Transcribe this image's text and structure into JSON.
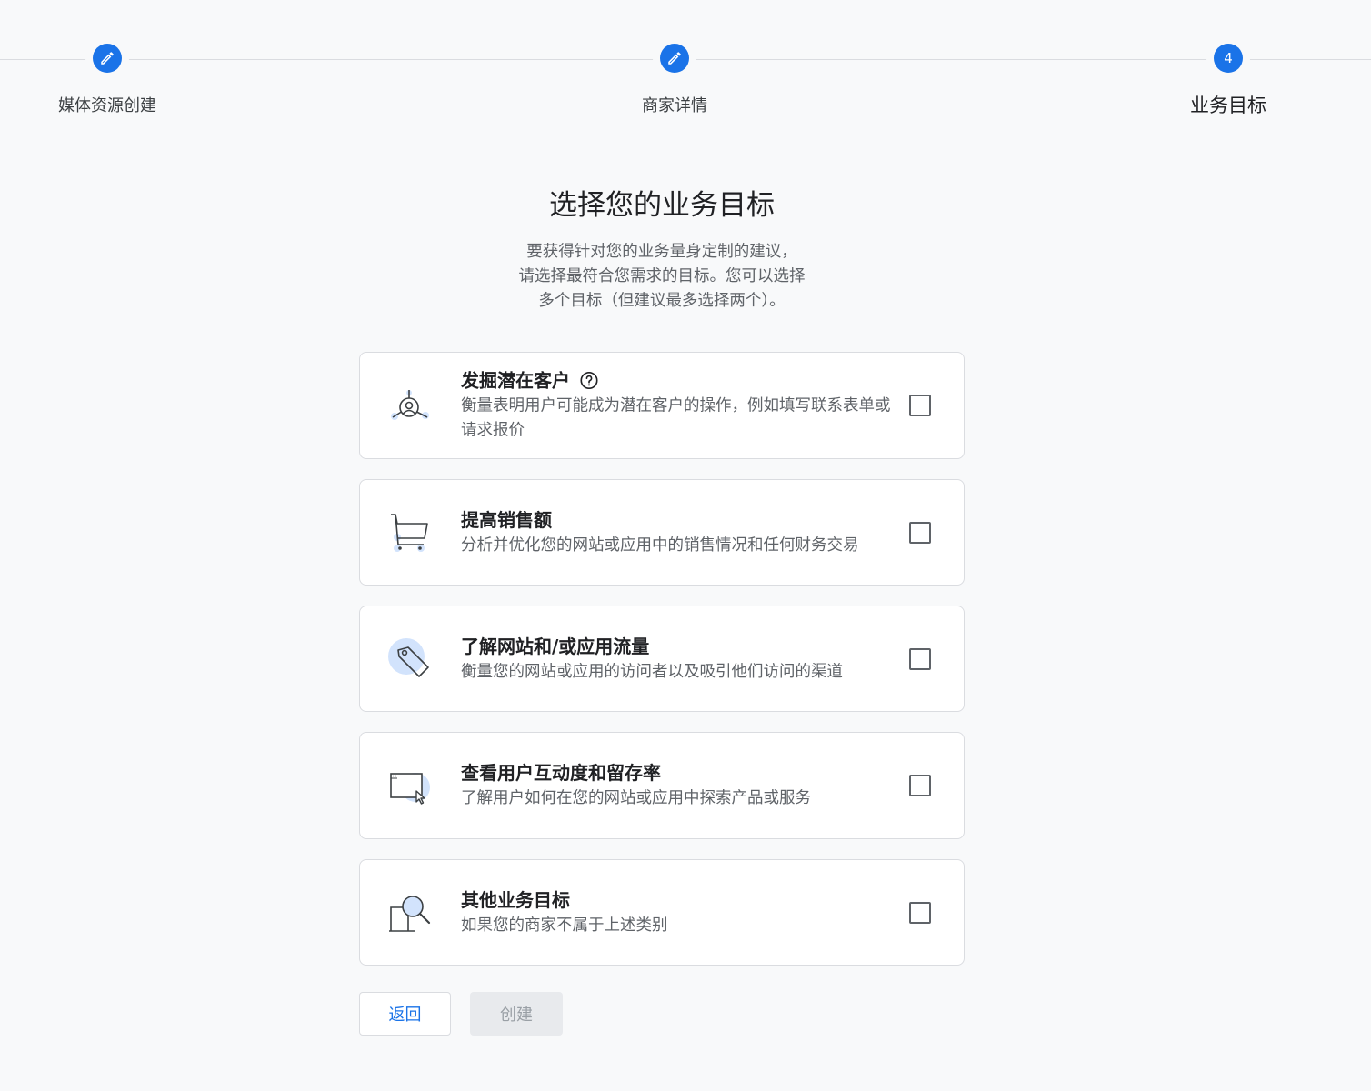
{
  "stepper": {
    "steps": [
      {
        "label": "媒体资源创建",
        "state": "completed",
        "icon": "pencil-icon"
      },
      {
        "label": "商家详情",
        "state": "completed",
        "icon": "pencil-icon"
      },
      {
        "label": "业务目标",
        "state": "active",
        "number": "4"
      }
    ]
  },
  "header": {
    "title": "选择您的业务目标",
    "description_lines": [
      "要获得针对您的业务量身定制的建议，",
      "请选择最符合您需求的目标。您可以选择",
      "多个目标（但建议最多选择两个）。"
    ]
  },
  "goals": [
    {
      "title": "发掘潜在客户",
      "description": "衡量表明用户可能成为潜在客户的操作，例如填写联系表单或请求报价",
      "icon": "lead-network-icon",
      "has_help": true,
      "checked": false
    },
    {
      "title": "提高销售额",
      "description": "分析并优化您的网站或应用中的销售情况和任何财务交易",
      "icon": "shopping-cart-icon",
      "checked": false
    },
    {
      "title": "了解网站和/或应用流量",
      "description": "衡量您的网站或应用的访问者以及吸引他们访问的渠道",
      "icon": "tag-icon",
      "checked": false
    },
    {
      "title": "查看用户互动度和留存率",
      "description": "了解用户如何在您的网站或应用中探索产品或服务",
      "icon": "browser-cursor-icon",
      "checked": false
    },
    {
      "title": "其他业务目标",
      "description": "如果您的商家不属于上述类别",
      "icon": "magnifier-document-icon",
      "checked": false
    }
  ],
  "actions": {
    "back_label": "返回",
    "create_label": "创建"
  },
  "colors": {
    "accent": "#1a73e8",
    "icon_fill": "#d2e3fc",
    "border": "#dadce0",
    "disabled_bg": "#e8eaed"
  }
}
